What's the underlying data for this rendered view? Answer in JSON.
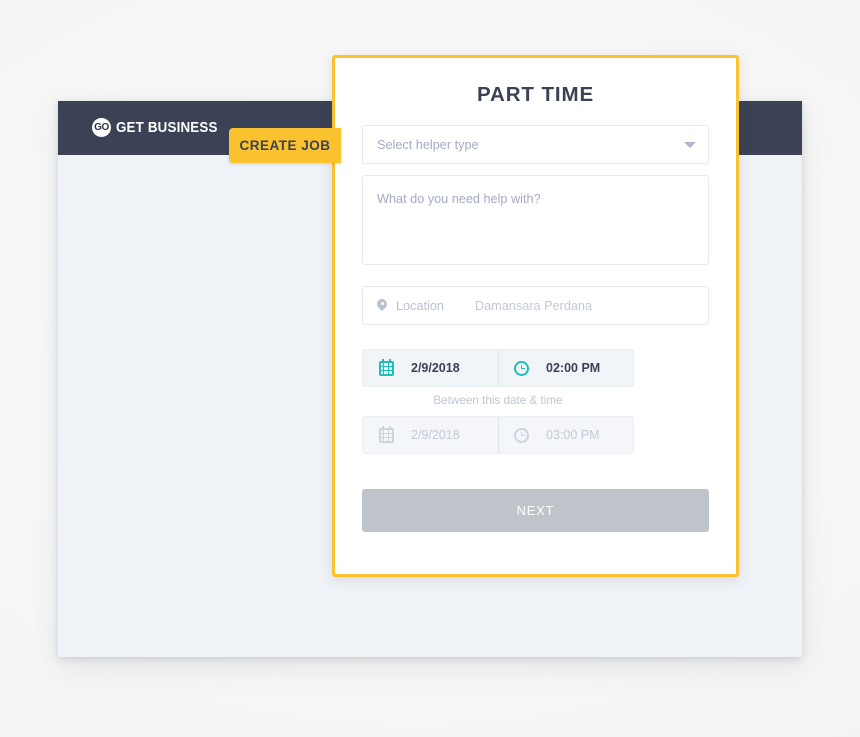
{
  "app": {
    "brand_badge": "GO",
    "brand_name": "GET BUSINESS"
  },
  "tab": {
    "create_job_label": "CREATE JOB"
  },
  "modal": {
    "title": "PART TIME",
    "helper_type": {
      "placeholder": "Select helper type",
      "value": ""
    },
    "description": {
      "placeholder": "What do you need help with?",
      "value": ""
    },
    "location": {
      "label": "Location",
      "placeholder": "Damansara Perdana",
      "value": ""
    },
    "schedule": {
      "caption": "Between this date & time",
      "start": {
        "date": "2/9/2018",
        "time": "02:00 PM"
      },
      "end": {
        "date": "2/9/2018",
        "time": "03:00 PM"
      }
    },
    "next_label": "NEXT"
  },
  "colors": {
    "accent_yellow": "#f9c22e",
    "header_navy": "#3b4256",
    "teal_icon": "#1fbfb8",
    "disabled_button": "#bfc4cb",
    "page_bg": "#eff2f6"
  }
}
